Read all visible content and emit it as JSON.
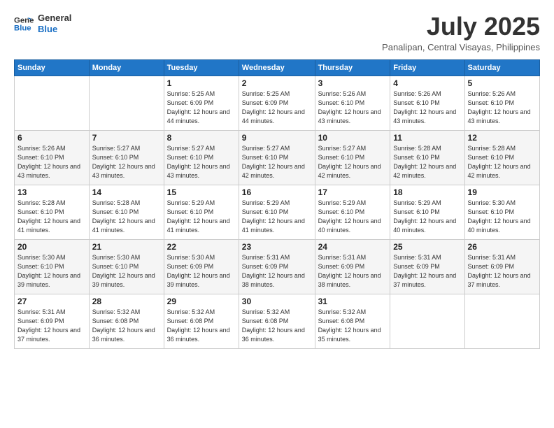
{
  "logo": {
    "text_general": "General",
    "text_blue": "Blue"
  },
  "header": {
    "title": "July 2025",
    "subtitle": "Panalipan, Central Visayas, Philippines"
  },
  "weekdays": [
    "Sunday",
    "Monday",
    "Tuesday",
    "Wednesday",
    "Thursday",
    "Friday",
    "Saturday"
  ],
  "weeks": [
    [
      {
        "day": "",
        "info": ""
      },
      {
        "day": "",
        "info": ""
      },
      {
        "day": "1",
        "info": "Sunrise: 5:25 AM\nSunset: 6:09 PM\nDaylight: 12 hours and 44 minutes."
      },
      {
        "day": "2",
        "info": "Sunrise: 5:25 AM\nSunset: 6:09 PM\nDaylight: 12 hours and 44 minutes."
      },
      {
        "day": "3",
        "info": "Sunrise: 5:26 AM\nSunset: 6:10 PM\nDaylight: 12 hours and 43 minutes."
      },
      {
        "day": "4",
        "info": "Sunrise: 5:26 AM\nSunset: 6:10 PM\nDaylight: 12 hours and 43 minutes."
      },
      {
        "day": "5",
        "info": "Sunrise: 5:26 AM\nSunset: 6:10 PM\nDaylight: 12 hours and 43 minutes."
      }
    ],
    [
      {
        "day": "6",
        "info": "Sunrise: 5:26 AM\nSunset: 6:10 PM\nDaylight: 12 hours and 43 minutes."
      },
      {
        "day": "7",
        "info": "Sunrise: 5:27 AM\nSunset: 6:10 PM\nDaylight: 12 hours and 43 minutes."
      },
      {
        "day": "8",
        "info": "Sunrise: 5:27 AM\nSunset: 6:10 PM\nDaylight: 12 hours and 43 minutes."
      },
      {
        "day": "9",
        "info": "Sunrise: 5:27 AM\nSunset: 6:10 PM\nDaylight: 12 hours and 42 minutes."
      },
      {
        "day": "10",
        "info": "Sunrise: 5:27 AM\nSunset: 6:10 PM\nDaylight: 12 hours and 42 minutes."
      },
      {
        "day": "11",
        "info": "Sunrise: 5:28 AM\nSunset: 6:10 PM\nDaylight: 12 hours and 42 minutes."
      },
      {
        "day": "12",
        "info": "Sunrise: 5:28 AM\nSunset: 6:10 PM\nDaylight: 12 hours and 42 minutes."
      }
    ],
    [
      {
        "day": "13",
        "info": "Sunrise: 5:28 AM\nSunset: 6:10 PM\nDaylight: 12 hours and 41 minutes."
      },
      {
        "day": "14",
        "info": "Sunrise: 5:28 AM\nSunset: 6:10 PM\nDaylight: 12 hours and 41 minutes."
      },
      {
        "day": "15",
        "info": "Sunrise: 5:29 AM\nSunset: 6:10 PM\nDaylight: 12 hours and 41 minutes."
      },
      {
        "day": "16",
        "info": "Sunrise: 5:29 AM\nSunset: 6:10 PM\nDaylight: 12 hours and 41 minutes."
      },
      {
        "day": "17",
        "info": "Sunrise: 5:29 AM\nSunset: 6:10 PM\nDaylight: 12 hours and 40 minutes."
      },
      {
        "day": "18",
        "info": "Sunrise: 5:29 AM\nSunset: 6:10 PM\nDaylight: 12 hours and 40 minutes."
      },
      {
        "day": "19",
        "info": "Sunrise: 5:30 AM\nSunset: 6:10 PM\nDaylight: 12 hours and 40 minutes."
      }
    ],
    [
      {
        "day": "20",
        "info": "Sunrise: 5:30 AM\nSunset: 6:10 PM\nDaylight: 12 hours and 39 minutes."
      },
      {
        "day": "21",
        "info": "Sunrise: 5:30 AM\nSunset: 6:10 PM\nDaylight: 12 hours and 39 minutes."
      },
      {
        "day": "22",
        "info": "Sunrise: 5:30 AM\nSunset: 6:09 PM\nDaylight: 12 hours and 39 minutes."
      },
      {
        "day": "23",
        "info": "Sunrise: 5:31 AM\nSunset: 6:09 PM\nDaylight: 12 hours and 38 minutes."
      },
      {
        "day": "24",
        "info": "Sunrise: 5:31 AM\nSunset: 6:09 PM\nDaylight: 12 hours and 38 minutes."
      },
      {
        "day": "25",
        "info": "Sunrise: 5:31 AM\nSunset: 6:09 PM\nDaylight: 12 hours and 37 minutes."
      },
      {
        "day": "26",
        "info": "Sunrise: 5:31 AM\nSunset: 6:09 PM\nDaylight: 12 hours and 37 minutes."
      }
    ],
    [
      {
        "day": "27",
        "info": "Sunrise: 5:31 AM\nSunset: 6:09 PM\nDaylight: 12 hours and 37 minutes."
      },
      {
        "day": "28",
        "info": "Sunrise: 5:32 AM\nSunset: 6:08 PM\nDaylight: 12 hours and 36 minutes."
      },
      {
        "day": "29",
        "info": "Sunrise: 5:32 AM\nSunset: 6:08 PM\nDaylight: 12 hours and 36 minutes."
      },
      {
        "day": "30",
        "info": "Sunrise: 5:32 AM\nSunset: 6:08 PM\nDaylight: 12 hours and 36 minutes."
      },
      {
        "day": "31",
        "info": "Sunrise: 5:32 AM\nSunset: 6:08 PM\nDaylight: 12 hours and 35 minutes."
      },
      {
        "day": "",
        "info": ""
      },
      {
        "day": "",
        "info": ""
      }
    ]
  ]
}
